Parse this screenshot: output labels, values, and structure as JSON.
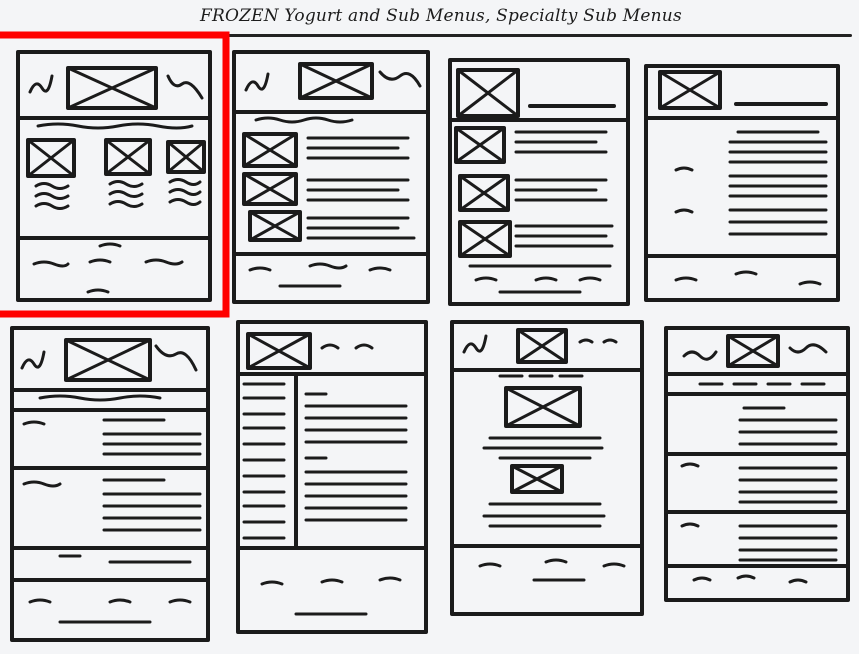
{
  "sheet": {
    "title": "FROZEN Yogurt and Sub Menus, Specialty Sub Menus",
    "selected_sketch_index": 0,
    "highlight_color": "#ff0000",
    "ink_color": "#1b1b1b",
    "paper_color": "#f4f5f7"
  },
  "sketches": [
    {
      "name": "sketch-1-featured-grid",
      "layout": "header with image, three-column image grid with text, footer text"
    },
    {
      "name": "sketch-2-image-list",
      "layout": "header with image, image rows with text, footer"
    },
    {
      "name": "sketch-3-image-list-alt",
      "layout": "header with image at left, image rows with text, footer"
    },
    {
      "name": "sketch-4-text-list",
      "layout": "header with image at left, text rows, footer"
    },
    {
      "name": "sketch-5-two-column-sections",
      "layout": "header with image, sectioned text rows, footer"
    },
    {
      "name": "sketch-6-sidebar",
      "layout": "header with image, left sidebar, content text, footer"
    },
    {
      "name": "sketch-7-centered-images",
      "layout": "header with image, centered images with text, footer"
    },
    {
      "name": "sketch-8-sectioned-text",
      "layout": "header with centered image, sectioned text rows, footer"
    }
  ]
}
